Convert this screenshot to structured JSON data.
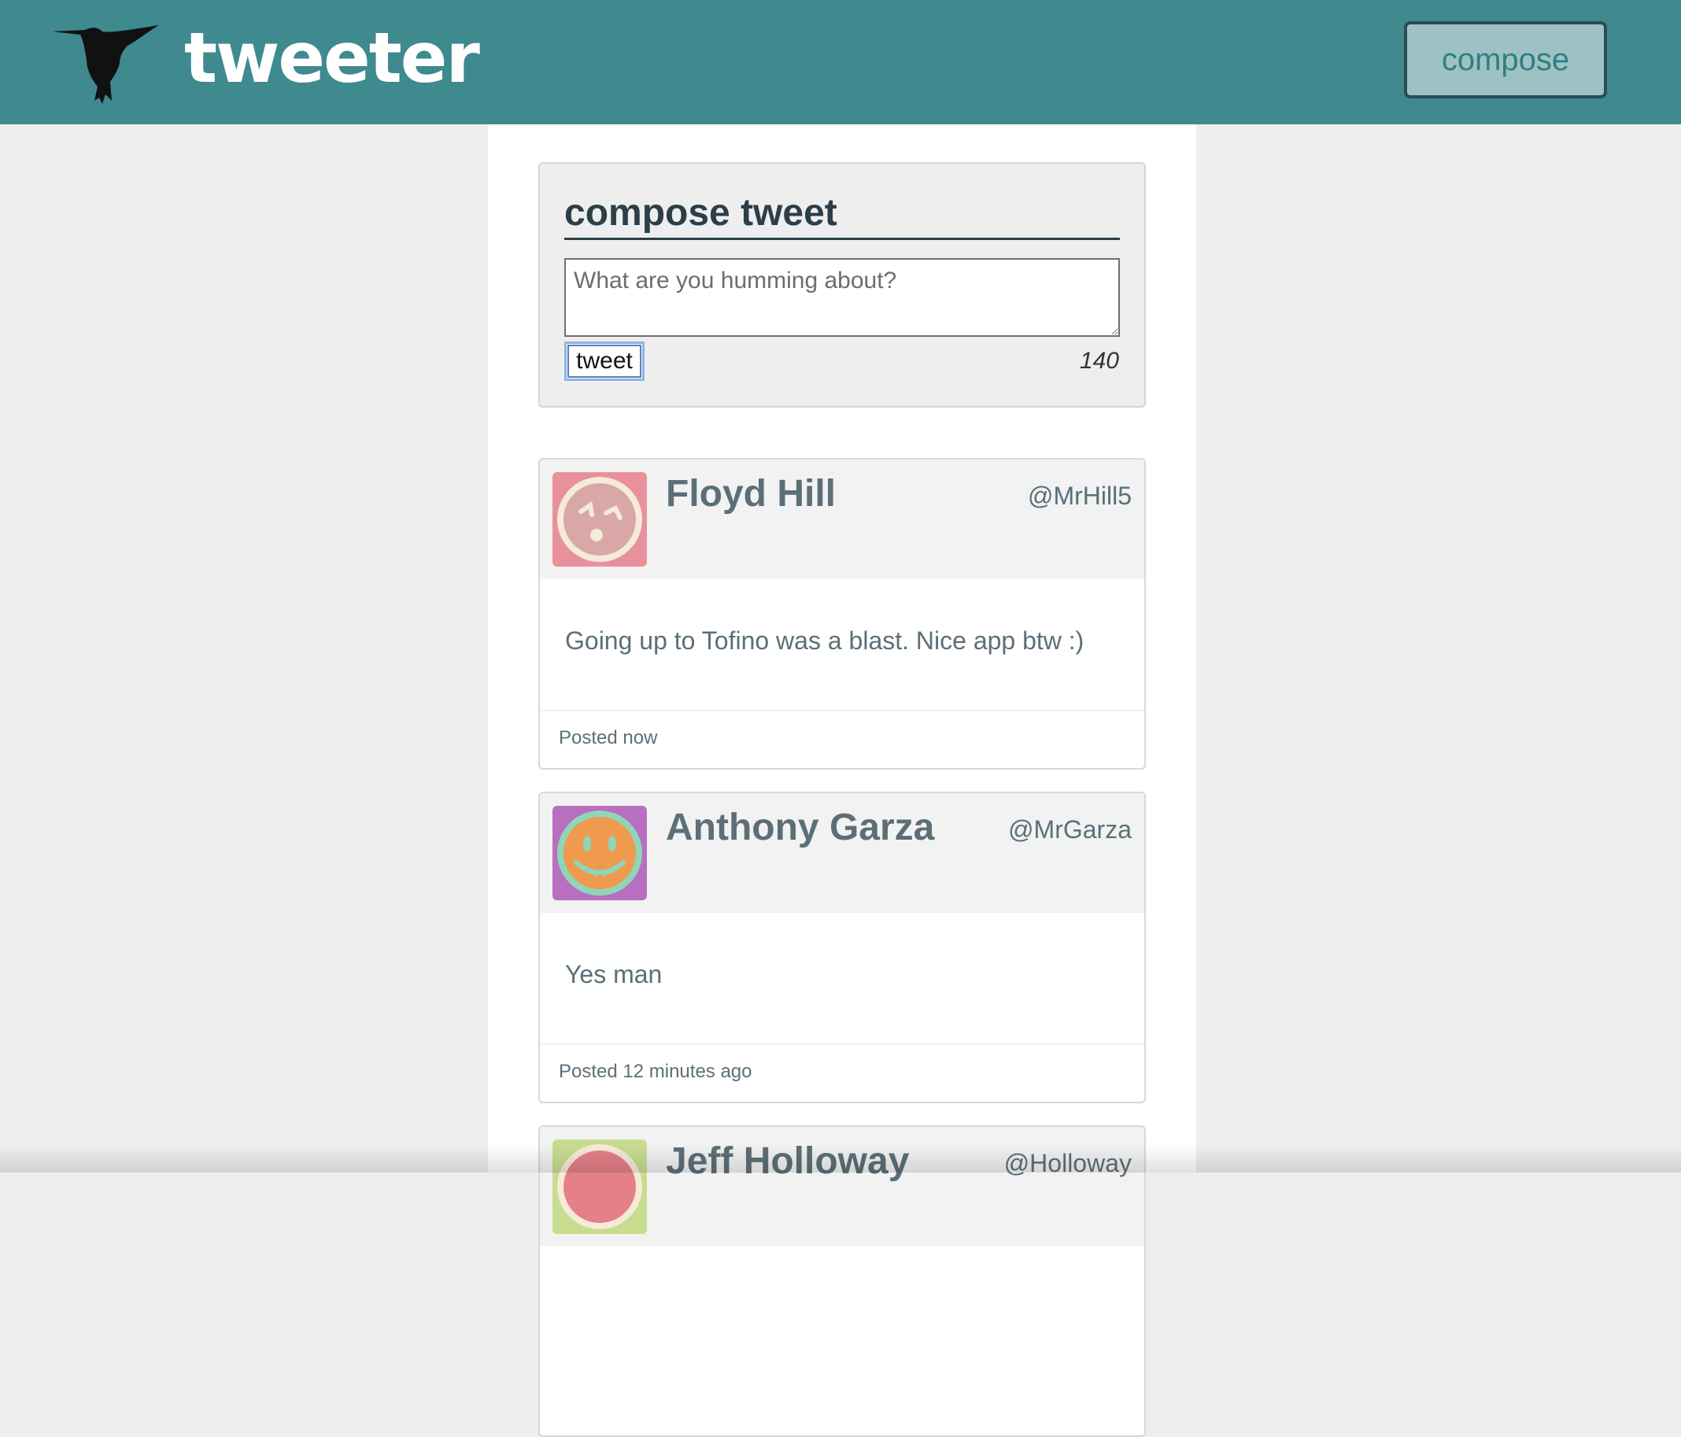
{
  "nav": {
    "brand": "tweeter",
    "compose_label": "compose",
    "color": "#3e8a8f"
  },
  "compose": {
    "title": "compose tweet",
    "placeholder": "What are you humming about?",
    "value": "",
    "button_label": "tweet",
    "counter": "140"
  },
  "tweets": [
    {
      "name": "Floyd Hill",
      "handle": "@MrHill5",
      "content": "Going up to Tofino was a blast. Nice app btw :)",
      "posted": "Posted now",
      "avatar_bg": "#e8919c",
      "avatar_icon": "surprised-face-icon"
    },
    {
      "name": "Anthony Garza",
      "handle": "@MrGarza",
      "content": "Yes man",
      "posted": "Posted 12 minutes ago",
      "avatar_bg": "#b86fbf",
      "avatar_icon": "grinning-face-icon"
    },
    {
      "name": "Jeff Holloway",
      "handle": "@Holloway",
      "avatar_bg": "#c8dc8f",
      "avatar_icon": "face-icon"
    }
  ]
}
